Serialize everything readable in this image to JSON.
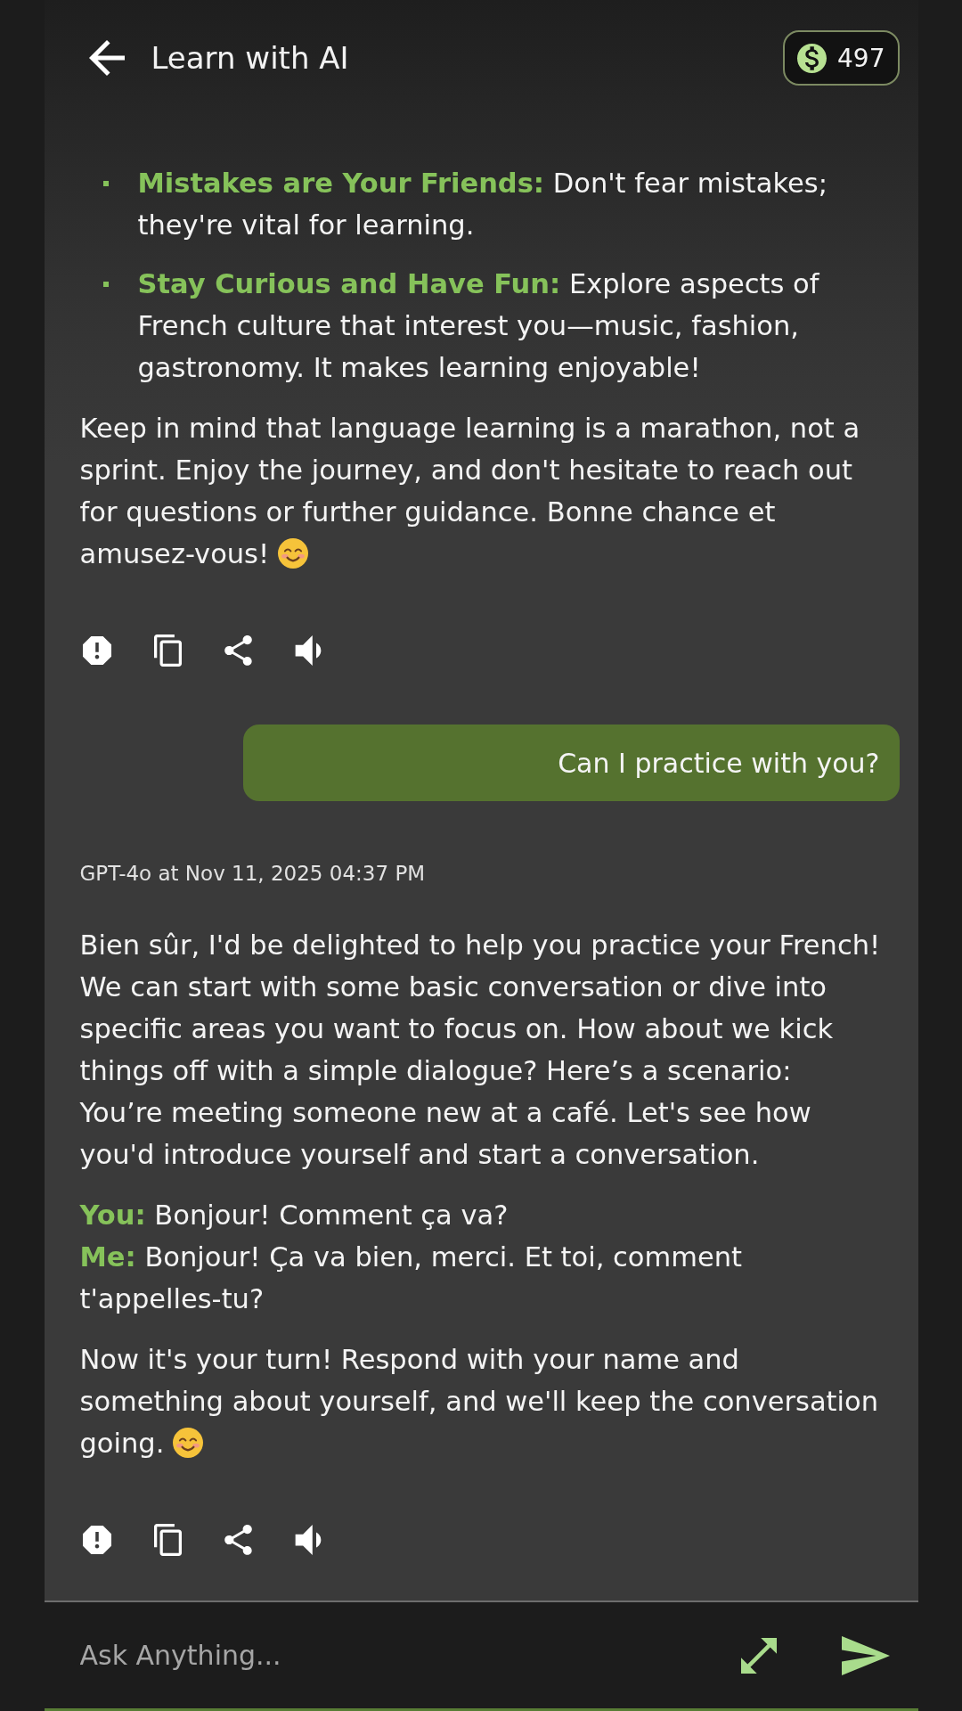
{
  "header": {
    "title": "Learn with AI",
    "coins": "497"
  },
  "messages": [
    {
      "kind": "assistant",
      "blocks": [
        {
          "kind": "list",
          "items": [
            {
              "label": "Mistakes are Your Friends:",
              "text": "Don't fear mistakes; they're vital for learning."
            },
            {
              "label": "Stay Curious and Have Fun:",
              "text": "Explore aspects of French culture that interest you—music, fashion, gastronomy. It makes learning enjoyable!"
            }
          ]
        },
        {
          "kind": "paragraph",
          "text": "Keep in mind that language learning is a marathon, not a sprint. Enjoy the journey, and don't hesitate to reach out for questions or further guidance. Bonne chance et amusez-vous!",
          "emoji": true
        }
      ]
    },
    {
      "kind": "user",
      "text": "Can I practice with you?"
    },
    {
      "kind": "assistant",
      "meta": "GPT-4o at Nov 11, 2025 04:37 PM",
      "blocks": [
        {
          "kind": "paragraph",
          "text": "Bien sûr, I'd be delighted to help you practice your French! We can start with some basic conversation or dive into specific areas you want to focus on. How about we kick things off with a simple dialogue? Here’s a scenario: You’re meeting someone new at a café. Let's see how you'd introduce yourself and start a conversation."
        },
        {
          "kind": "dialogue",
          "lines": [
            {
              "speaker": "You:",
              "text": "Bonjour! Comment ça va?"
            },
            {
              "speaker": "Me:",
              "text": "Bonjour! Ça va bien, merci. Et toi, comment t'appelles-tu?"
            }
          ]
        },
        {
          "kind": "paragraph",
          "text": "Now it's your turn! Respond with your name and something about yourself, and we'll keep the conversation going.",
          "emoji": true
        }
      ]
    }
  ],
  "composer": {
    "placeholder": "Ask Anything..."
  }
}
